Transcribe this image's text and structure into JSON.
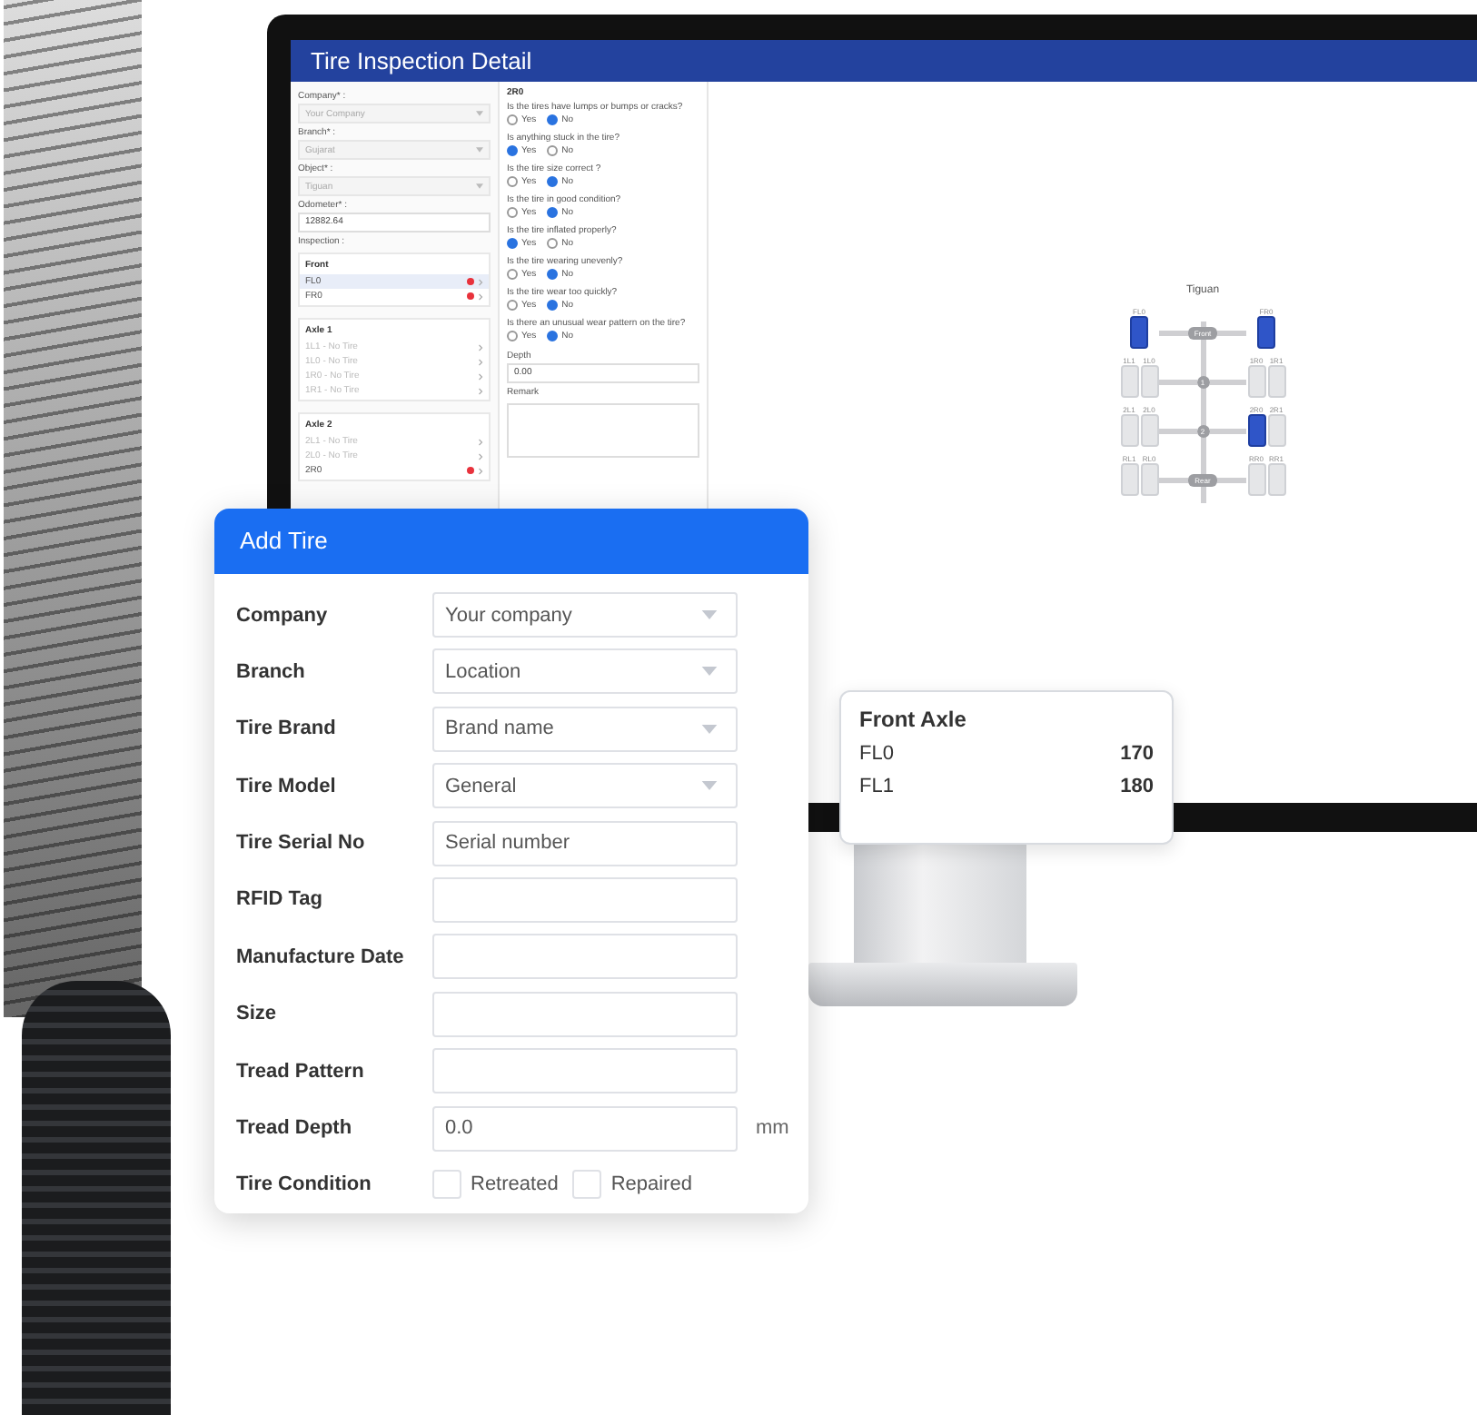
{
  "inspection_window": {
    "title": "Tire Inspection Detail",
    "fields": [
      {
        "label": "Company* :",
        "value": "Your Company",
        "kind": "select",
        "disabled": true
      },
      {
        "label": "Branch* :",
        "value": "Gujarat",
        "kind": "select",
        "disabled": true
      },
      {
        "label": "Object* :",
        "value": "Tiguan",
        "kind": "select",
        "disabled": true
      },
      {
        "label": "Odometer* :",
        "value": "12882.64",
        "kind": "text"
      }
    ],
    "inspection_label": "Inspection :",
    "groups": [
      {
        "title": "Front",
        "items": [
          {
            "label": "FL0",
            "selected": true,
            "alert": true,
            "disabled": false
          },
          {
            "label": "FR0",
            "selected": false,
            "alert": true,
            "disabled": false
          }
        ]
      },
      {
        "title": "Axle 1",
        "items": [
          {
            "label": "1L1 - No Tire",
            "selected": false,
            "alert": false,
            "disabled": true
          },
          {
            "label": "1L0 - No Tire",
            "selected": false,
            "alert": false,
            "disabled": true
          },
          {
            "label": "1R0 - No Tire",
            "selected": false,
            "alert": false,
            "disabled": true
          },
          {
            "label": "1R1 - No Tire",
            "selected": false,
            "alert": false,
            "disabled": true
          }
        ]
      },
      {
        "title": "Axle 2",
        "items": [
          {
            "label": "2L1 - No Tire",
            "selected": false,
            "alert": false,
            "disabled": true
          },
          {
            "label": "2L0 - No Tire",
            "selected": false,
            "alert": false,
            "disabled": true
          },
          {
            "label": "2R0",
            "selected": false,
            "alert": true,
            "disabled": false
          }
        ]
      }
    ],
    "tire_heading": "2R0",
    "questions": [
      {
        "text": "Is the tires have lumps or bumps or cracks?",
        "options": [
          {
            "label": "Yes",
            "selected": false
          },
          {
            "label": "No",
            "selected": true
          }
        ]
      },
      {
        "text": "Is anything stuck in the tire?",
        "options": [
          {
            "label": "Yes",
            "selected": true
          },
          {
            "label": "No",
            "selected": false
          }
        ]
      },
      {
        "text": "Is the tire size correct ?",
        "options": [
          {
            "label": "Yes",
            "selected": false
          },
          {
            "label": "No",
            "selected": true
          }
        ]
      },
      {
        "text": "Is the tire in good condition?",
        "options": [
          {
            "label": "Yes",
            "selected": false
          },
          {
            "label": "No",
            "selected": true
          }
        ]
      },
      {
        "text": "Is the tire inflated properly?",
        "options": [
          {
            "label": "Yes",
            "selected": true
          },
          {
            "label": "No",
            "selected": false
          }
        ]
      },
      {
        "text": "Is the tire wearing unevenly?",
        "options": [
          {
            "label": "Yes",
            "selected": false
          },
          {
            "label": "No",
            "selected": true
          }
        ]
      },
      {
        "text": "Is the tire wear too quickly?",
        "options": [
          {
            "label": "Yes",
            "selected": false
          },
          {
            "label": "No",
            "selected": true
          }
        ]
      },
      {
        "text": "Is there an unusual wear pattern on the tire?",
        "options": [
          {
            "label": "Yes",
            "selected": false
          },
          {
            "label": "No",
            "selected": true
          }
        ]
      }
    ],
    "depth": {
      "label": "Depth",
      "value": "0.00"
    },
    "remark": {
      "label": "Remark"
    },
    "diagram": {
      "title": "Tiguan",
      "axles": [
        {
          "hub": "Front",
          "left": [
            {
              "label": "FL0",
              "selected": true
            }
          ],
          "right": [
            {
              "label": "FR0",
              "selected": true
            }
          ]
        },
        {
          "hub": "1",
          "left": [
            {
              "label": "1L1",
              "selected": false
            },
            {
              "label": "1L0",
              "selected": false
            }
          ],
          "right": [
            {
              "label": "1R0",
              "selected": false
            },
            {
              "label": "1R1",
              "selected": false
            }
          ]
        },
        {
          "hub": "2",
          "left": [
            {
              "label": "2L1",
              "selected": false
            },
            {
              "label": "2L0",
              "selected": false
            }
          ],
          "right": [
            {
              "label": "2R0",
              "selected": true
            },
            {
              "label": "2R1",
              "selected": false
            }
          ]
        },
        {
          "hub": "Rear",
          "left": [
            {
              "label": "RL1",
              "selected": false
            },
            {
              "label": "RL0",
              "selected": false
            }
          ],
          "right": [
            {
              "label": "RR0",
              "selected": false
            },
            {
              "label": "RR1",
              "selected": false
            }
          ]
        }
      ]
    }
  },
  "add_tire": {
    "title": "Add Tire",
    "fields": [
      {
        "label": "Company",
        "kind": "select",
        "value": "Your company"
      },
      {
        "label": "Branch",
        "kind": "select",
        "value": "Location"
      },
      {
        "label": "Tire Brand",
        "kind": "select",
        "value": "Brand name"
      },
      {
        "label": "Tire Model",
        "kind": "select",
        "value": "General"
      },
      {
        "label": "Tire Serial No",
        "kind": "text",
        "placeholder": "Serial number"
      },
      {
        "label": "RFID Tag",
        "kind": "text"
      },
      {
        "label": "Manufacture Date",
        "kind": "text"
      },
      {
        "label": "Size",
        "kind": "text"
      },
      {
        "label": "Tread Pattern",
        "kind": "text"
      },
      {
        "label": "Tread Depth",
        "kind": "unit",
        "value": "0.0",
        "unit": "mm"
      },
      {
        "label": "Tire Condition",
        "kind": "checks",
        "options": [
          {
            "label": "Retreated",
            "checked": false
          },
          {
            "label": "Repaired",
            "checked": false
          }
        ]
      }
    ]
  },
  "axle_card": {
    "title": "Front Axle",
    "rows": [
      {
        "name": "FL0",
        "value": "170"
      },
      {
        "name": "FL1",
        "value": "180"
      }
    ]
  }
}
